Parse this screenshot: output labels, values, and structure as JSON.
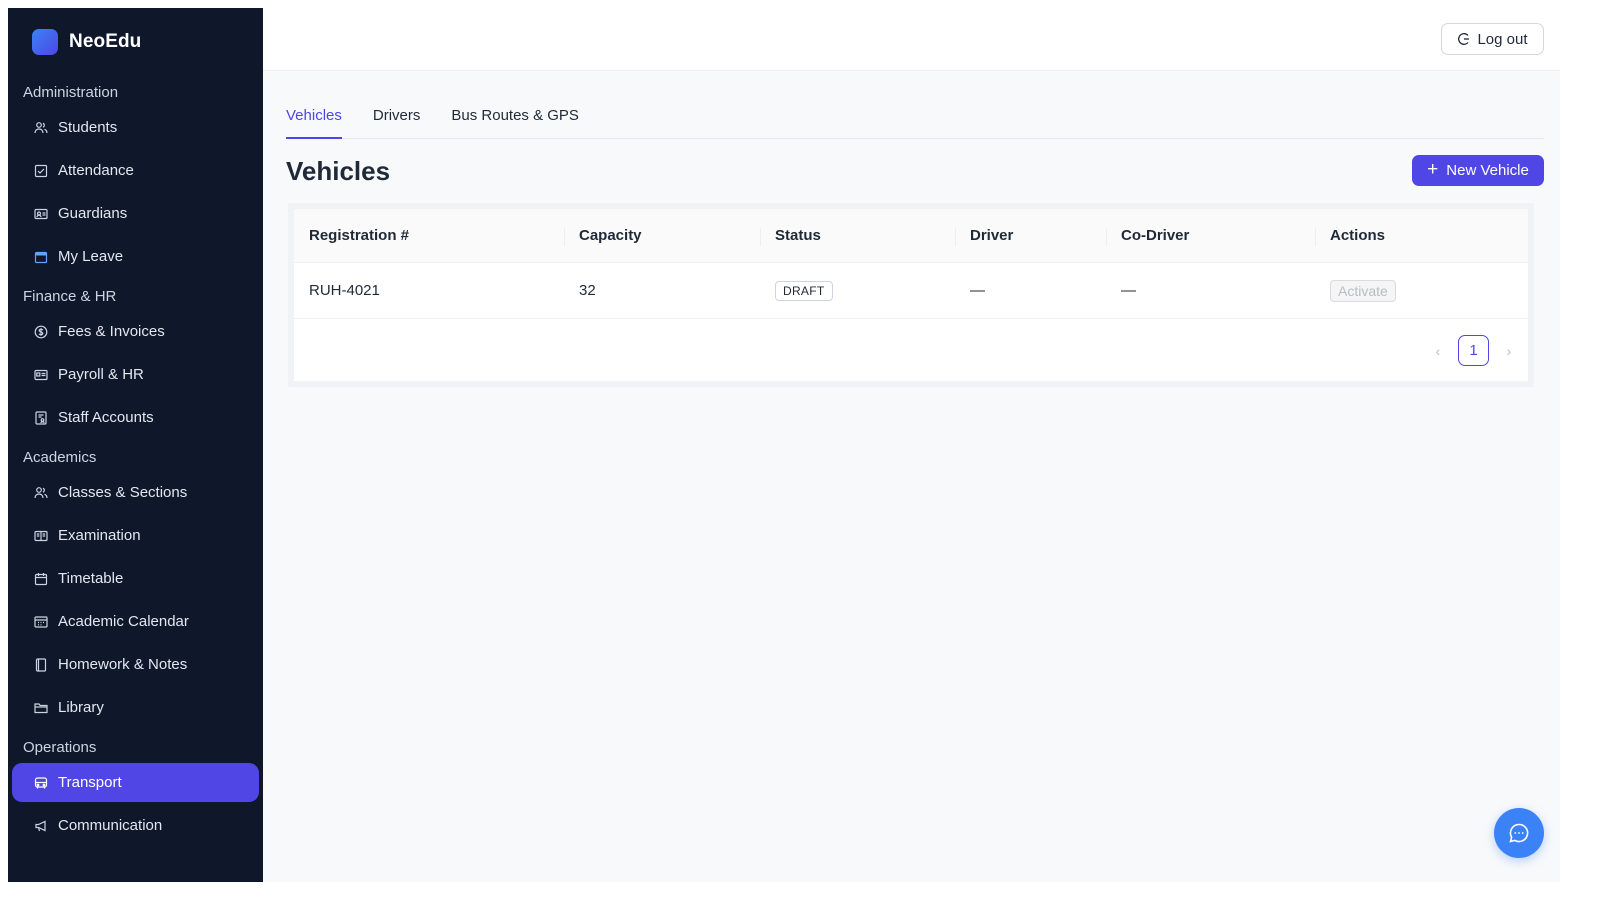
{
  "brand": {
    "name": "NeoEdu"
  },
  "sidebar": {
    "sections": [
      {
        "title": "Administration",
        "items": [
          {
            "label": "Students",
            "icon": "users-icon"
          },
          {
            "label": "Attendance",
            "icon": "checkbox-icon"
          },
          {
            "label": "Guardians",
            "icon": "id-card-icon"
          },
          {
            "label": "My Leave",
            "icon": "calendar-icon"
          }
        ]
      },
      {
        "title": "Finance & HR",
        "items": [
          {
            "label": "Fees & Invoices",
            "icon": "dollar-circle-icon"
          },
          {
            "label": "Payroll & HR",
            "icon": "id-badge-icon"
          },
          {
            "label": "Staff Accounts",
            "icon": "staff-doc-icon"
          }
        ]
      },
      {
        "title": "Academics",
        "items": [
          {
            "label": "Classes & Sections",
            "icon": "users-icon"
          },
          {
            "label": "Examination",
            "icon": "book-open-icon"
          },
          {
            "label": "Timetable",
            "icon": "calendar-icon"
          },
          {
            "label": "Academic Calendar",
            "icon": "calendar-grid-icon"
          },
          {
            "label": "Homework & Notes",
            "icon": "notebook-icon"
          },
          {
            "label": "Library",
            "icon": "folder-icon"
          }
        ]
      },
      {
        "title": "Operations",
        "items": [
          {
            "label": "Transport",
            "icon": "bus-icon",
            "active": true
          },
          {
            "label": "Communication",
            "icon": "megaphone-icon"
          }
        ]
      }
    ]
  },
  "topbar": {
    "logout_label": "Log out"
  },
  "tabs": [
    {
      "label": "Vehicles",
      "active": true
    },
    {
      "label": "Drivers"
    },
    {
      "label": "Bus Routes & GPS"
    }
  ],
  "page": {
    "title": "Vehicles",
    "new_button_label": "New Vehicle"
  },
  "table": {
    "columns": [
      "Registration #",
      "Capacity",
      "Status",
      "Driver",
      "Co-Driver",
      "Actions"
    ],
    "rows": [
      {
        "registration": "RUH-4021",
        "capacity": "32",
        "status": "DRAFT",
        "driver": "—",
        "co_driver": "—",
        "action": "Activate"
      }
    ]
  },
  "pagination": {
    "current_page": "1"
  },
  "colors": {
    "accent": "#4f46e5",
    "sidebar_bg": "#0f172a",
    "chat_fab": "#3b82f6"
  }
}
